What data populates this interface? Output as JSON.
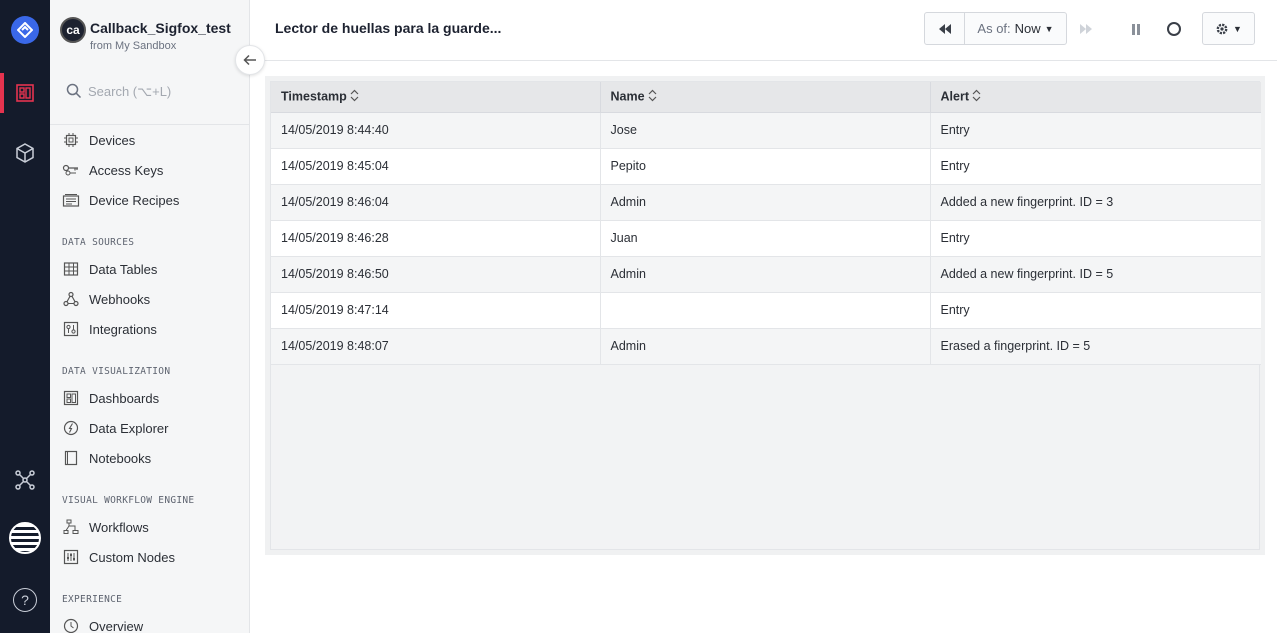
{
  "app": {
    "name": "Callback_Sigfox_test",
    "source": "from My Sandbox",
    "avatar_text": "ca"
  },
  "search": {
    "placeholder": "Search (⌥+L)"
  },
  "sidebar": {
    "top_items": [
      {
        "label": "Devices",
        "icon": "chip-icon"
      },
      {
        "label": "Access Keys",
        "icon": "keys-icon"
      },
      {
        "label": "Device Recipes",
        "icon": "recipes-icon"
      }
    ],
    "sections": [
      {
        "title": "DATA SOURCES",
        "items": [
          {
            "label": "Data Tables",
            "icon": "table-icon"
          },
          {
            "label": "Webhooks",
            "icon": "webhook-icon"
          },
          {
            "label": "Integrations",
            "icon": "integrations-icon"
          }
        ]
      },
      {
        "title": "DATA VISUALIZATION",
        "items": [
          {
            "label": "Dashboards",
            "icon": "dashboard-icon"
          },
          {
            "label": "Data Explorer",
            "icon": "compass-icon"
          },
          {
            "label": "Notebooks",
            "icon": "notebook-icon"
          }
        ]
      },
      {
        "title": "VISUAL WORKFLOW ENGINE",
        "items": [
          {
            "label": "Workflows",
            "icon": "workflow-icon"
          },
          {
            "label": "Custom Nodes",
            "icon": "sliders-icon"
          }
        ]
      },
      {
        "title": "EXPERIENCE",
        "items": [
          {
            "label": "Overview",
            "icon": "overview-icon"
          }
        ]
      }
    ]
  },
  "header": {
    "title": "Lector de huellas para la guarde...",
    "as_of_label": "As of:",
    "as_of_value": "Now"
  },
  "table": {
    "columns": [
      "Timestamp",
      "Name",
      "Alert"
    ],
    "rows": [
      [
        "14/05/2019 8:44:40",
        "Jose",
        "Entry"
      ],
      [
        "14/05/2019 8:45:04",
        "Pepito",
        "Entry"
      ],
      [
        "14/05/2019 8:46:04",
        "Admin",
        "Added a new fingerprint. ID = 3"
      ],
      [
        "14/05/2019 8:46:28",
        "Juan",
        "Entry"
      ],
      [
        "14/05/2019 8:46:50",
        "Admin",
        "Added a new fingerprint. ID = 5"
      ],
      [
        "14/05/2019 8:47:14",
        "",
        "Entry"
      ],
      [
        "14/05/2019 8:48:07",
        "Admin",
        "Erased a fingerprint. ID = 5"
      ]
    ]
  },
  "colors": {
    "rail_bg": "#141b2b",
    "accent_red": "#e5334f",
    "logo_blue": "#3a68e8",
    "sidebar_bg": "#f5f6f7"
  }
}
